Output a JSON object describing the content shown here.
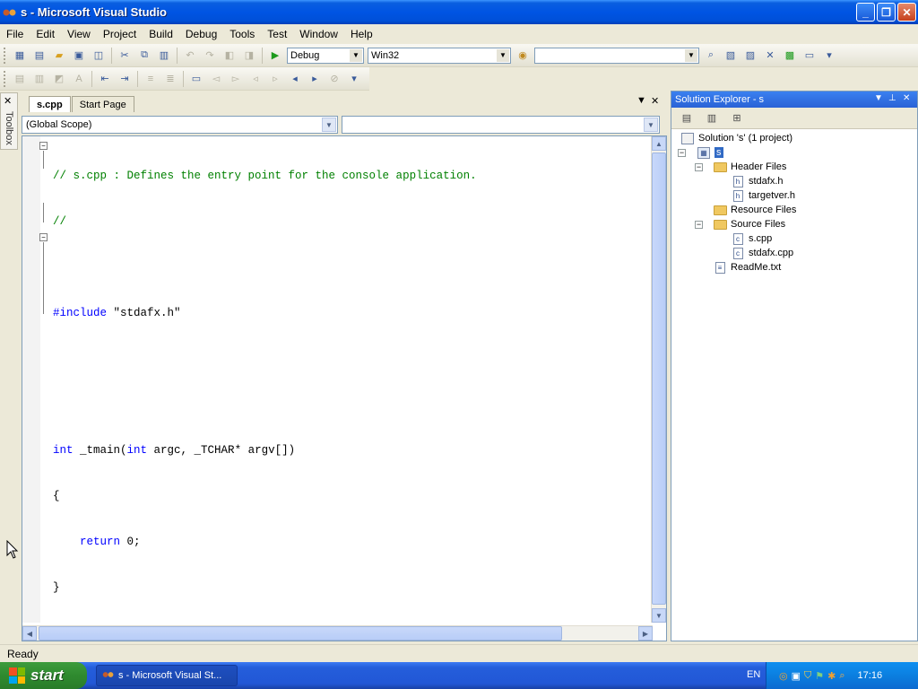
{
  "window": {
    "title": "s - Microsoft Visual Studio",
    "minimize_glyph": "_",
    "maximize_glyph": "❐",
    "close_glyph": "✕"
  },
  "menu": [
    "File",
    "Edit",
    "View",
    "Project",
    "Build",
    "Debug",
    "Tools",
    "Test",
    "Window",
    "Help"
  ],
  "toolbar": {
    "config": "Debug",
    "platform": "Win32",
    "find_value": ""
  },
  "toolbox": {
    "label": "Toolbox"
  },
  "document": {
    "tabs": [
      "s.cpp",
      "Start Page"
    ],
    "active_tab": "s.cpp",
    "scope": "(Global Scope)",
    "member": "",
    "code": [
      {
        "text": "// s.cpp : Defines the entry point for the console application.",
        "cls": "cm"
      },
      {
        "text": "//",
        "cls": "cm"
      },
      {
        "text": "",
        "cls": ""
      },
      {
        "text": "#include \"stdafx.h\"",
        "cls": "inc"
      },
      {
        "text": "",
        "cls": ""
      },
      {
        "text": "",
        "cls": ""
      },
      {
        "text": "int _tmain(int argc, _TCHAR* argv[])",
        "cls": "fn"
      },
      {
        "text": "{",
        "cls": ""
      },
      {
        "text": "    return 0;",
        "cls": "ret"
      },
      {
        "text": "}",
        "cls": ""
      },
      {
        "text": "",
        "cls": ""
      }
    ]
  },
  "solution_explorer": {
    "title": "Solution Explorer - s",
    "solution": "Solution 's' (1 project)",
    "project": "s",
    "header_files": "Header Files",
    "header_items": [
      "stdafx.h",
      "targetver.h"
    ],
    "resource_files": "Resource Files",
    "source_files": "Source Files",
    "source_items": [
      "s.cpp",
      "stdafx.cpp"
    ],
    "readme": "ReadMe.txt"
  },
  "status": "Ready",
  "taskbar": {
    "start": "start",
    "task": "s - Microsoft Visual St...",
    "lang": "EN",
    "time": "17:16"
  },
  "colors": {
    "titlebar": "#0054e3",
    "comment": "#008000",
    "keyword": "#0000ff",
    "selection": "#316ac5"
  }
}
